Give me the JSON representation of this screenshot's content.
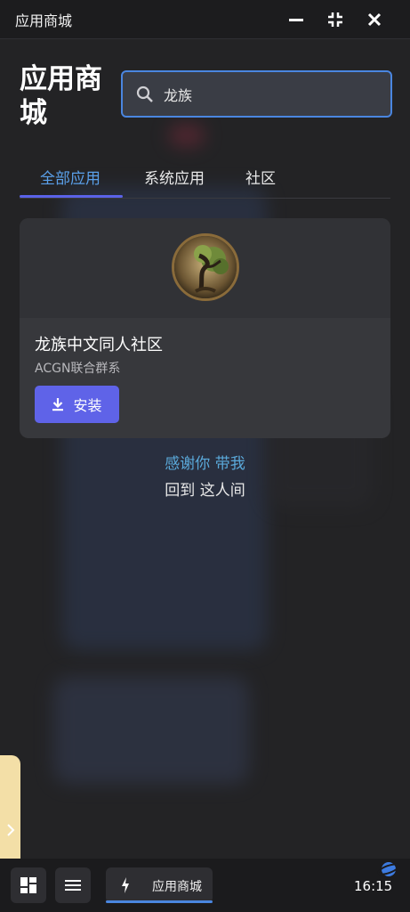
{
  "window": {
    "title": "应用商城",
    "controls": [
      "minimize-icon",
      "shrink-icon",
      "close-icon"
    ]
  },
  "header": {
    "title": "应用商城",
    "search": {
      "value": "龙族",
      "placeholder": ""
    }
  },
  "tabs": [
    {
      "label": "全部应用",
      "active": true
    },
    {
      "label": "系统应用",
      "active": false
    },
    {
      "label": "社区",
      "active": false
    }
  ],
  "app_card": {
    "name": "龙族中文同人社区",
    "subtitle": "ACGN联合群系",
    "install_label": "安装"
  },
  "tagline": {
    "line1": "感谢你 带我",
    "line2": "回到 这人间"
  },
  "taskbar": {
    "app_name": "应用商城",
    "time": "16:15"
  },
  "colors": {
    "accent": "#5f63e8",
    "tab_active": "#5aa0ea",
    "search_border": "#4a86e0",
    "side_handle": "#f3dfa7"
  }
}
